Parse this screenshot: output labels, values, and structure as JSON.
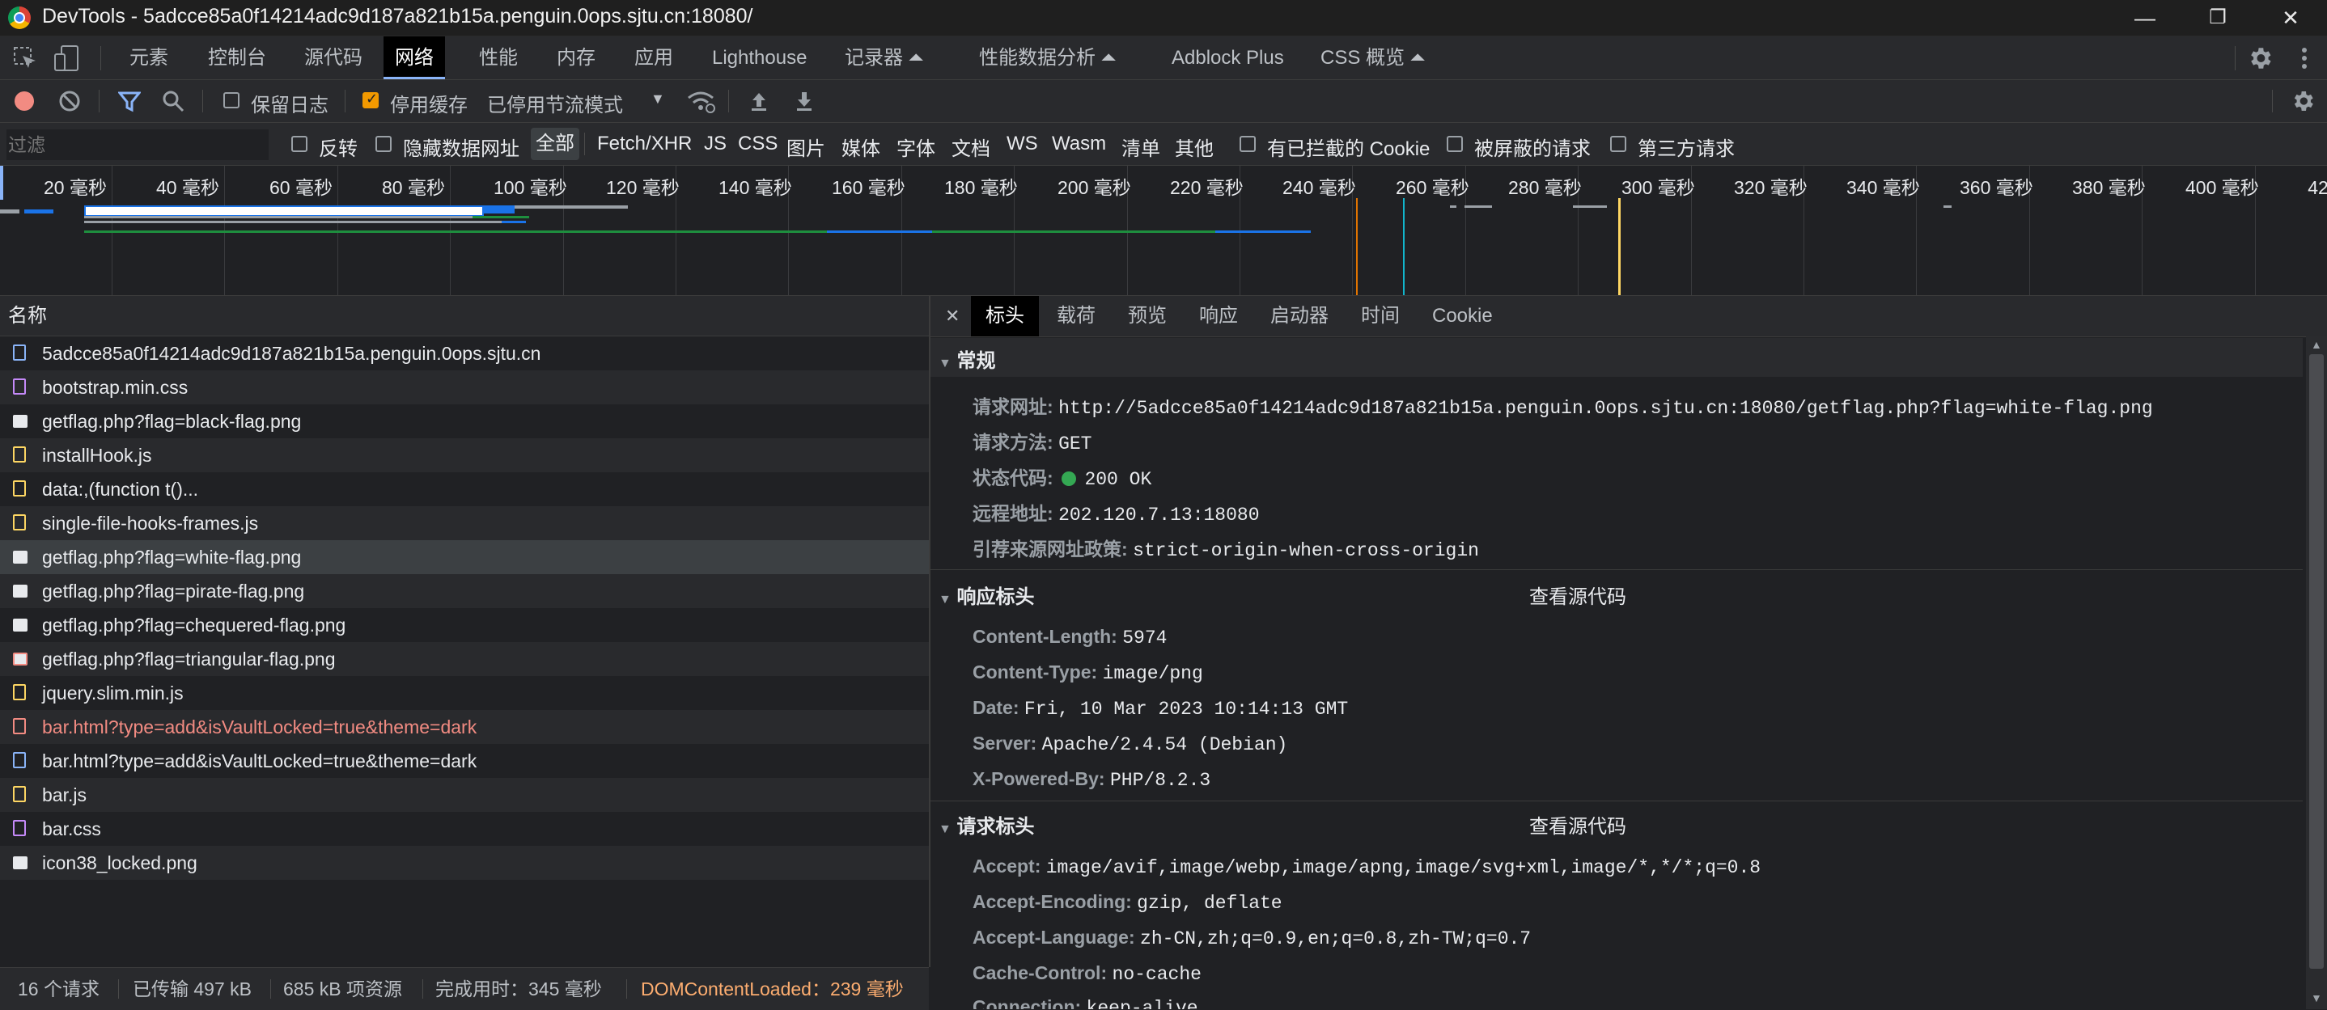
{
  "window": {
    "title": "DevTools - 5adcce85a0f14214adc9d187a821b15a.penguin.0ops.sjtu.cn:18080/",
    "minimize": "—",
    "restore": "❐",
    "close": "✕"
  },
  "main_tabs": [
    {
      "label": "元素"
    },
    {
      "label": "控制台"
    },
    {
      "label": "源代码"
    },
    {
      "label": "网络"
    },
    {
      "label": "性能"
    },
    {
      "label": "内存"
    },
    {
      "label": "应用"
    },
    {
      "label": "Lighthouse"
    },
    {
      "label": "记录器 ⏶"
    },
    {
      "label": "性能数据分析 ⏶"
    },
    {
      "label": "Adblock Plus"
    },
    {
      "label": "CSS 概览 ⏶"
    }
  ],
  "toolbar": {
    "preserve_log": "保留日志",
    "disable_cache": "停用缓存",
    "throttle": "已停用节流模式",
    "dropdown": "▼"
  },
  "filterbar": {
    "placeholder": "过滤",
    "invert": "反转",
    "hide_data_urls": "隐藏数据网址",
    "types": [
      "全部",
      "Fetch/XHR",
      "JS",
      "CSS",
      "图片",
      "媒体",
      "字体",
      "文档",
      "WS",
      "Wasm",
      "清单",
      "其他"
    ],
    "blocked_cookies": "有已拦截的 Cookie",
    "blocked_requests": "被屏蔽的请求",
    "third_party": "第三方请求"
  },
  "timeline": {
    "ticks": [
      "20 毫秒",
      "40 毫秒",
      "60 毫秒",
      "80 毫秒",
      "100 毫秒",
      "120 毫秒",
      "140 毫秒",
      "160 毫秒",
      "180 毫秒",
      "200 毫秒",
      "220 毫秒",
      "240 毫秒",
      "260 毫秒",
      "280 毫秒",
      "300 毫秒",
      "320 毫秒",
      "340 毫秒",
      "360 毫秒",
      "380 毫秒",
      "400 毫秒",
      "420 毫"
    ]
  },
  "requests": {
    "header": "名称",
    "items": [
      {
        "name": "5adcce85a0f14214adc9d187a821b15a.penguin.0ops.sjtu.cn",
        "icon": "document-icon"
      },
      {
        "name": "bootstrap.min.css",
        "icon": "css-icon"
      },
      {
        "name": "getflag.php?flag=black-flag.png",
        "icon": "image-icon"
      },
      {
        "name": "installHook.js",
        "icon": "script-icon"
      },
      {
        "name": "data:,(function t()...",
        "icon": "script-icon"
      },
      {
        "name": "single-file-hooks-frames.js",
        "icon": "script-icon"
      },
      {
        "name": "getflag.php?flag=white-flag.png",
        "icon": "image-icon"
      },
      {
        "name": "getflag.php?flag=pirate-flag.png",
        "icon": "image-icon"
      },
      {
        "name": "getflag.php?flag=chequered-flag.png",
        "icon": "image-icon"
      },
      {
        "name": "getflag.php?flag=triangular-flag.png",
        "icon": "image-icon"
      },
      {
        "name": "jquery.slim.min.js",
        "icon": "script-icon"
      },
      {
        "name": "bar.html?type=add&isVaultLocked=true&theme=dark",
        "icon": "document-icon"
      },
      {
        "name": "bar.html?type=add&isVaultLocked=true&theme=dark",
        "icon": "document-icon"
      },
      {
        "name": "bar.js",
        "icon": "script-icon"
      },
      {
        "name": "bar.css",
        "icon": "css-icon"
      },
      {
        "name": "icon38_locked.png",
        "icon": "image-icon"
      }
    ]
  },
  "statusbar": {
    "count": "16 个请求",
    "transferred": "已传输 497 kB",
    "resources": "685 kB 项资源",
    "finish": "完成用时：345 毫秒",
    "dcl": "DOMContentLoaded：239 毫秒"
  },
  "details": {
    "close": "✕",
    "tabs": [
      "标头",
      "载荷",
      "预览",
      "响应",
      "启动器",
      "时间",
      "Cookie"
    ],
    "general": {
      "title": "常规",
      "rows": [
        {
          "k": "请求网址:",
          "v": "http://5adcce85a0f14214adc9d187a821b15a.penguin.0ops.sjtu.cn:18080/getflag.php?flag=white-flag.png"
        },
        {
          "k": "请求方法:",
          "v": "GET"
        },
        {
          "k": "状态代码:",
          "v": "200 OK"
        },
        {
          "k": "远程地址:",
          "v": "202.120.7.13:18080"
        },
        {
          "k": "引荐来源网址政策:",
          "v": "strict-origin-when-cross-origin"
        }
      ]
    },
    "response_headers": {
      "title": "响应标头",
      "view_source": "查看源代码",
      "rows": [
        {
          "k": "Content-Length:",
          "v": "5974"
        },
        {
          "k": "Content-Type:",
          "v": "image/png"
        },
        {
          "k": "Date:",
          "v": "Fri, 10 Mar 2023 10:14:13 GMT"
        },
        {
          "k": "Server:",
          "v": "Apache/2.4.54 (Debian)"
        },
        {
          "k": "X-Powered-By:",
          "v": "PHP/8.2.3"
        }
      ]
    },
    "request_headers": {
      "title": "请求标头",
      "view_source": "查看源代码",
      "rows": [
        {
          "k": "Accept:",
          "v": "image/avif,image/webp,image/apng,image/svg+xml,image/*,*/*;q=0.8"
        },
        {
          "k": "Accept-Encoding:",
          "v": "gzip, deflate"
        },
        {
          "k": "Accept-Language:",
          "v": "zh-CN,zh;q=0.9,en;q=0.8,zh-TW;q=0.7"
        },
        {
          "k": "Cache-Control:",
          "v": "no-cache"
        },
        {
          "k": "Connection:",
          "v": "keep-alive"
        }
      ]
    }
  }
}
